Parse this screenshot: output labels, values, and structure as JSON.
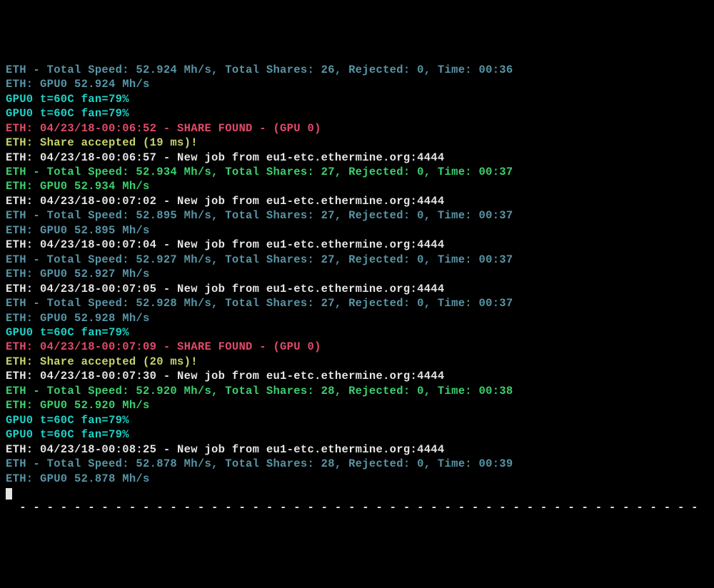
{
  "lines": [
    {
      "color": "c-blue",
      "text": "ETH - Total Speed: 52.924 Mh/s, Total Shares: 26, Rejected: 0, Time: 00:36"
    },
    {
      "color": "c-blue",
      "text": "ETH: GPU0 52.924 Mh/s"
    },
    {
      "color": "c-cyan",
      "text": "GPU0 t=60C fan=79%"
    },
    {
      "color": "c-cyan",
      "text": "GPU0 t=60C fan=79%"
    },
    {
      "color": "c-red",
      "text": "ETH: 04/23/18-00:06:52 - SHARE FOUND - (GPU 0)"
    },
    {
      "color": "c-green",
      "text": "ETH: Share accepted (19 ms)!"
    },
    {
      "color": "c-white",
      "text": "ETH: 04/23/18-00:06:57 - New job from eu1-etc.ethermine.org:4444"
    },
    {
      "color": "c-lime",
      "text": "ETH - Total Speed: 52.934 Mh/s, Total Shares: 27, Rejected: 0, Time: 00:37"
    },
    {
      "color": "c-lime",
      "text": "ETH: GPU0 52.934 Mh/s"
    },
    {
      "color": "c-white",
      "text": "ETH: 04/23/18-00:07:02 - New job from eu1-etc.ethermine.org:4444"
    },
    {
      "color": "c-blue",
      "text": "ETH - Total Speed: 52.895 Mh/s, Total Shares: 27, Rejected: 0, Time: 00:37"
    },
    {
      "color": "c-blue",
      "text": "ETH: GPU0 52.895 Mh/s"
    },
    {
      "color": "c-white",
      "text": "ETH: 04/23/18-00:07:04 - New job from eu1-etc.ethermine.org:4444"
    },
    {
      "color": "c-blue",
      "text": "ETH - Total Speed: 52.927 Mh/s, Total Shares: 27, Rejected: 0, Time: 00:37"
    },
    {
      "color": "c-blue",
      "text": "ETH: GPU0 52.927 Mh/s"
    },
    {
      "color": "c-white",
      "text": "ETH: 04/23/18-00:07:05 - New job from eu1-etc.ethermine.org:4444"
    },
    {
      "color": "c-blue",
      "text": "ETH - Total Speed: 52.928 Mh/s, Total Shares: 27, Rejected: 0, Time: 00:37"
    },
    {
      "color": "c-blue",
      "text": "ETH: GPU0 52.928 Mh/s"
    },
    {
      "color": "c-cyan",
      "text": "GPU0 t=60C fan=79%"
    },
    {
      "color": "c-red",
      "text": "ETH: 04/23/18-00:07:09 - SHARE FOUND - (GPU 0)"
    },
    {
      "color": "c-green",
      "text": "ETH: Share accepted (20 ms)!"
    },
    {
      "color": "c-white",
      "text": "ETH: 04/23/18-00:07:30 - New job from eu1-etc.ethermine.org:4444"
    },
    {
      "color": "c-lime",
      "text": "ETH - Total Speed: 52.920 Mh/s, Total Shares: 28, Rejected: 0, Time: 00:38"
    },
    {
      "color": "c-lime",
      "text": "ETH: GPU0 52.920 Mh/s"
    },
    {
      "color": "c-cyan",
      "text": "GPU0 t=60C fan=79%"
    },
    {
      "color": "c-cyan",
      "text": "GPU0 t=60C fan=79%"
    },
    {
      "color": "c-white",
      "text": "ETH: 04/23/18-00:08:25 - New job from eu1-etc.ethermine.org:4444"
    },
    {
      "color": "c-blue",
      "text": "ETH - Total Speed: 52.878 Mh/s, Total Shares: 28, Rejected: 0, Time: 00:39"
    },
    {
      "color": "c-blue",
      "text": "ETH: GPU0 52.878 Mh/s"
    }
  ],
  "separator": "  - - - - - - - - - - - - - - - - - - - - - - - - - - - - - - - - - - - - - - - - - - - - - - - - - -"
}
